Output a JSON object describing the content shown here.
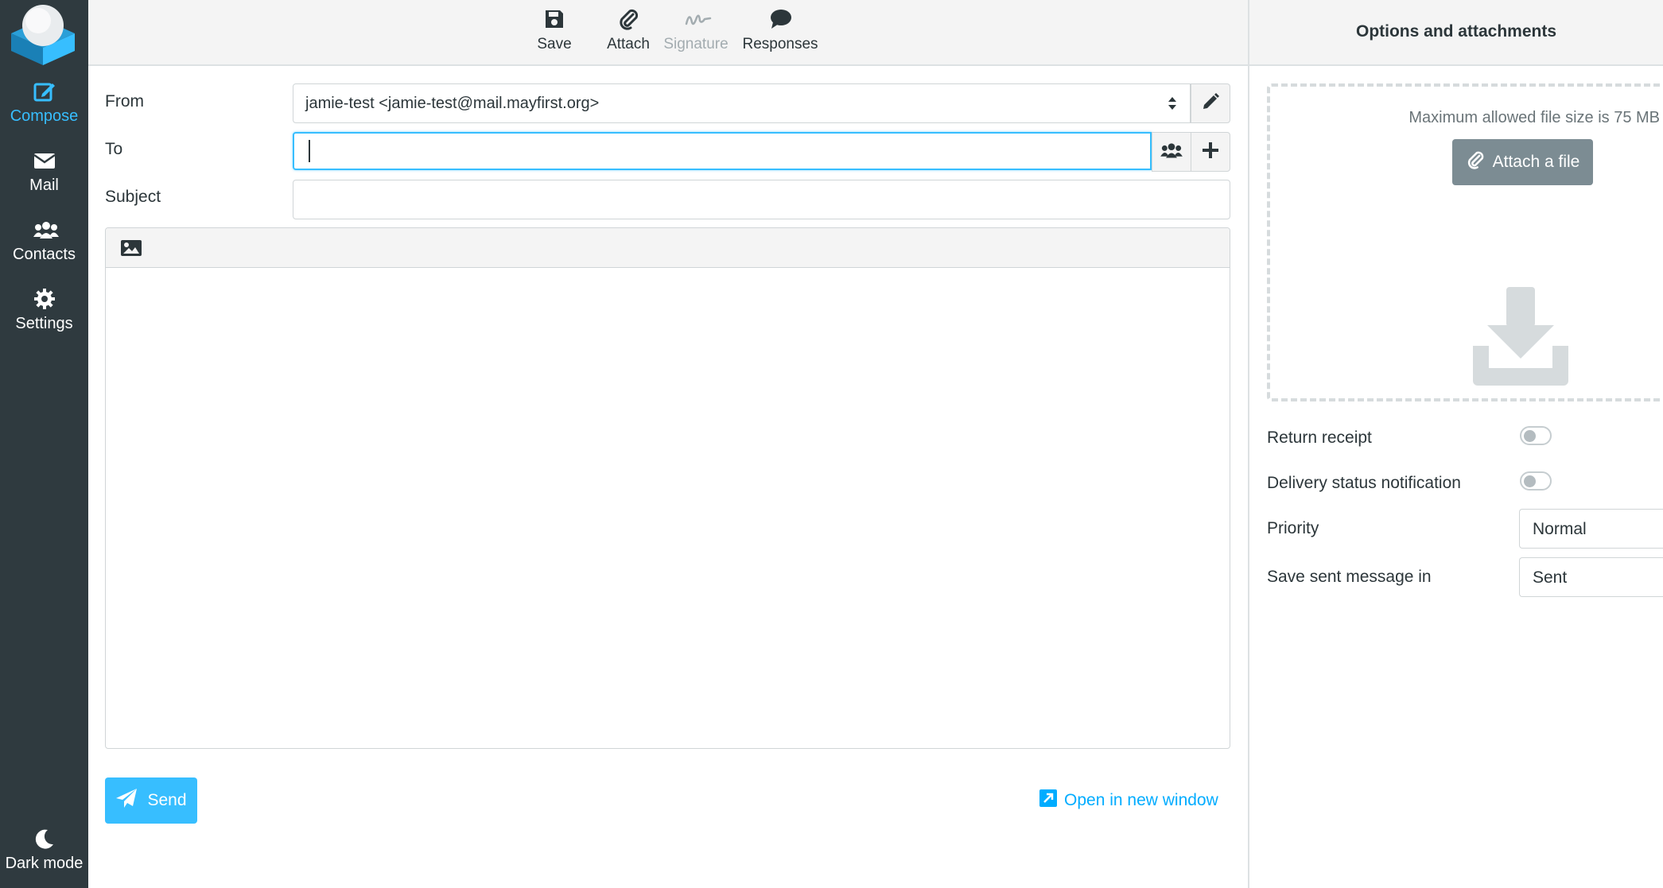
{
  "nav": {
    "items": [
      {
        "label": "Compose",
        "icon": "compose-icon",
        "active": true
      },
      {
        "label": "Mail",
        "icon": "envelope-icon",
        "active": false
      },
      {
        "label": "Contacts",
        "icon": "users-icon",
        "active": false
      },
      {
        "label": "Settings",
        "icon": "gear-icon",
        "active": false
      }
    ],
    "dark_mode_label": "Dark mode"
  },
  "toolbar": {
    "save_label": "Save",
    "attach_label": "Attach",
    "signature_label": "Signature",
    "responses_label": "Responses"
  },
  "form": {
    "from_label": "From",
    "from_value": "jamie-test <jamie-test@mail.mayfirst.org>",
    "to_label": "To",
    "to_value": "",
    "subject_label": "Subject",
    "subject_value": ""
  },
  "footer": {
    "send_label": "Send",
    "open_new_window_label": "Open in new window"
  },
  "options": {
    "title": "Options and attachments",
    "max_size_text": "Maximum allowed file size is 75 MB",
    "attach_file_label": "Attach a file",
    "return_receipt_label": "Return receipt",
    "return_receipt_on": false,
    "dsn_label": "Delivery status notification",
    "dsn_on": false,
    "priority_label": "Priority",
    "priority_value": "Normal",
    "save_sent_label": "Save sent message in",
    "save_sent_value": "Sent"
  },
  "colors": {
    "accent": "#37beff",
    "sidebar_bg": "#2f3a3f",
    "link": "#00acff"
  }
}
